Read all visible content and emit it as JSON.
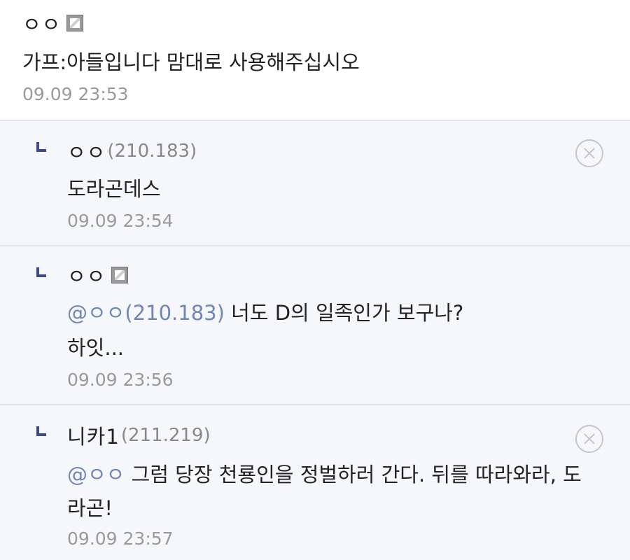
{
  "comments": [
    {
      "nick": "ㅇㅇ",
      "text": "가프:아들입니다 맘대로 사용해주십시오",
      "date": "09.09 23:53",
      "fixed_icon": "fixed-nick-icon"
    }
  ],
  "replies": [
    {
      "nick": "ㅇㅇ",
      "ip": "(210.183)",
      "text": "도라곤데스",
      "date": "09.09 23:54",
      "delete_icon": "delete-icon"
    },
    {
      "nick": "ㅇㅇ",
      "mention": "@ㅇㅇ(210.183)",
      "text_line1": " 너도 D의 일족인가 보구나?",
      "text_line2": "하잇...",
      "date": "09.09 23:56",
      "fixed_icon": "fixed-nick-icon"
    },
    {
      "nick": "니카1",
      "ip": "(211.219)",
      "mention": "@ㅇㅇ",
      "text_line1": " 그럼 당장 천룡인을 정벌하러 간다. 뒤를 따라와라, 도",
      "text_line2": "라곤!",
      "date": "09.09 23:57",
      "delete_icon": "delete-icon"
    }
  ],
  "colors": {
    "reply_bg": "#f6f7fb",
    "mention": "#6f86b5",
    "reply_arrow": "#3c4a8c",
    "date": "#9a9a9a"
  }
}
